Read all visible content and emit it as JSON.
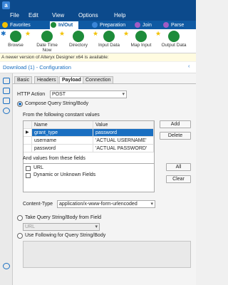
{
  "app": {
    "logo_letter": "a"
  },
  "menu": [
    "File",
    "Edit",
    "View",
    "Options",
    "Help"
  ],
  "ribbon_tabs": [
    {
      "label": "Favorites",
      "color": "#f2c100"
    },
    {
      "label": "In/Out",
      "color": "#1e8c3a"
    },
    {
      "label": "Preparation",
      "color": "#1a6fc1"
    },
    {
      "label": "Join",
      "color": "#8e44ad"
    },
    {
      "label": "Parse",
      "color": "#8e44ad"
    }
  ],
  "tools": [
    {
      "label": "Browse",
      "color": "#1e8c3a"
    },
    {
      "label": "Date Time Now",
      "color": "#1e8c3a"
    },
    {
      "label": "Directory",
      "color": "#1e8c3a"
    },
    {
      "label": "Input Data",
      "color": "#1e8c3a"
    },
    {
      "label": "Map Input",
      "color": "#1e8c3a"
    },
    {
      "label": "Output Data",
      "color": "#1e8c3a"
    }
  ],
  "notice": "A newer version of Alteryx Designer x64 is available:",
  "config": {
    "title": "Download (1) - Configuration",
    "tabs": [
      "Basic",
      "Headers",
      "Payload",
      "Connection"
    ],
    "active_tab": "Payload",
    "http_action_label": "HTTP Action",
    "http_action_value": "POST",
    "compose_label": "Compose Query String/Body",
    "constant_values_label": "From the following constant values",
    "grid_headers": [
      "Name",
      "Value"
    ],
    "grid_rows": [
      {
        "name": "grant_type",
        "value": "password"
      },
      {
        "name": "username",
        "value": "'ACTUAL USERNAME'"
      },
      {
        "name": "password",
        "value": "'ACTUAL PASSWORD'"
      }
    ],
    "add_button": "Add",
    "delete_button": "Delete",
    "fields_label": "And values from these fields",
    "fields": [
      "URL",
      "Dynamic or Unknown Fields"
    ],
    "all_button": "All",
    "clear_button": "Clear",
    "content_type_label": "Content-Type",
    "content_type_value": "application/x-www-form-urlencoded",
    "take_query_label": "Take Query String/Body from Field",
    "take_query_field": "URL",
    "use_following_label": "Use Following for Query String/Body"
  },
  "colors": {
    "accent": "#1a6fc1",
    "titlebar": "#0c4a8c",
    "selected_row": "#1a6fc1"
  }
}
